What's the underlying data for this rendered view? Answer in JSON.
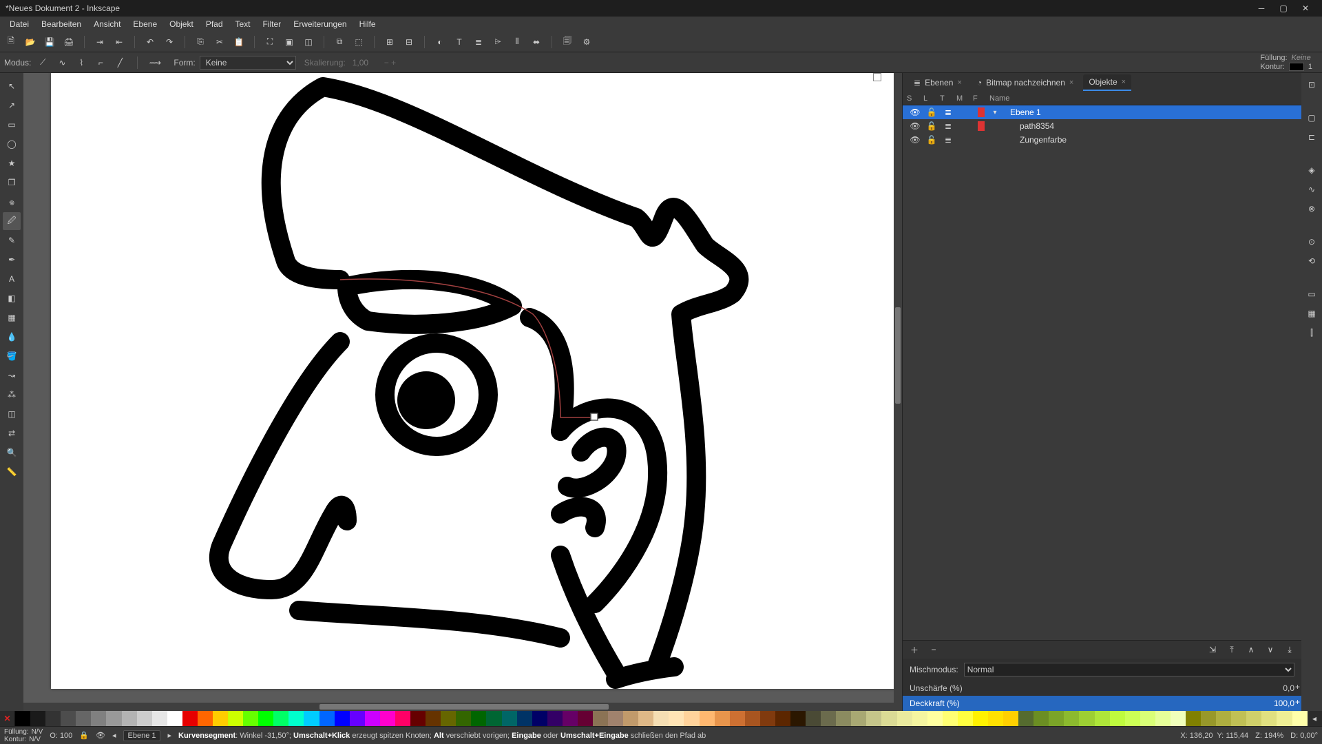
{
  "title": "*Neues Dokument 2 - Inkscape",
  "menu": [
    "Datei",
    "Bearbeiten",
    "Ansicht",
    "Ebene",
    "Objekt",
    "Pfad",
    "Text",
    "Filter",
    "Erweiterungen",
    "Hilfe"
  ],
  "tooloptions": {
    "modus_label": "Modus:",
    "form_label": "Form:",
    "form_value": "Keine",
    "scale_label": "Skalierung:",
    "scale_value": "1,00",
    "right_fill_label": "Füllung:",
    "right_fill_value": "Keine",
    "right_stroke_label": "Kontur:",
    "right_stroke_value": "1"
  },
  "dock": {
    "tabs": [
      {
        "label": "Ebenen",
        "close": "×"
      },
      {
        "label": "Bitmap nachzeichnen",
        "close": "×"
      },
      {
        "label": "Objekte",
        "close": "×"
      }
    ],
    "active_tab": 2,
    "headers": {
      "s": "S",
      "l": "L",
      "t": "T",
      "m": "M",
      "f": "F",
      "name": "Name"
    },
    "rows": [
      {
        "name": "Ebene 1",
        "selected": true,
        "expander": "▾",
        "color": "#de3333"
      },
      {
        "name": "path8354",
        "selected": false,
        "expander": "",
        "color": "#de3333",
        "indent": 1
      },
      {
        "name": "Zungenfarbe",
        "selected": false,
        "expander": "",
        "color": "",
        "indent": 1
      }
    ],
    "blend_label": "Mischmodus:",
    "blend_value": "Normal",
    "blur_label": "Unschärfe (%)",
    "blur_value": "0,0",
    "opacity_label": "Deckkraft (%)",
    "opacity_value": "100,0"
  },
  "status": {
    "fill_label": "Füllung:",
    "fill_value": "N/V",
    "stroke_label": "Kontur:",
    "stroke_value": "N/V",
    "o_label": "O:",
    "o_value": "100",
    "layer": "Ebene 1",
    "hint_prefix": "Kurvensegment",
    "hint_angle": ": Winkel -31,50°;",
    "hint_b1": "Umschalt+Klick",
    "hint_t1": " erzeugt spitzen Knoten; ",
    "hint_b2": "Alt",
    "hint_t2": " verschiebt vorigen; ",
    "hint_b3": "Eingabe",
    "hint_t3": " oder ",
    "hint_b4": "Umschalt+Eingabe",
    "hint_t4": " schließen den Pfad ab",
    "x_label": "X:",
    "x_value": "136,20",
    "y_label": "Y:",
    "y_value": "115,44",
    "z_label": "Z:",
    "z_value": "194%",
    "d_label": "D:",
    "d_value": "0,00°"
  },
  "palette_colors": [
    "#000000",
    "#1a1a1a",
    "#333333",
    "#4d4d4d",
    "#666666",
    "#808080",
    "#999999",
    "#b3b3b3",
    "#cccccc",
    "#e6e6e6",
    "#ffffff",
    "#e60000",
    "#ff6600",
    "#ffcc00",
    "#ccff00",
    "#66ff00",
    "#00ff00",
    "#00ff66",
    "#00ffcc",
    "#00ccff",
    "#0066ff",
    "#0000ff",
    "#6600ff",
    "#cc00ff",
    "#ff00cc",
    "#ff0066",
    "#660000",
    "#663300",
    "#666600",
    "#336600",
    "#006600",
    "#006633",
    "#006666",
    "#003366",
    "#000066",
    "#330066",
    "#660066",
    "#660033",
    "#8b7355",
    "#a0826d",
    "#c19a6b",
    "#deb887",
    "#f5deb3",
    "#ffe4b5",
    "#ffd39b",
    "#ffb870",
    "#e8954c",
    "#cd7032",
    "#a85520",
    "#803a0e",
    "#5c2600",
    "#2b1700",
    "#4a4a35",
    "#6b6b4d",
    "#8b8b60",
    "#a8a873",
    "#c5c58a",
    "#dbdb95",
    "#eaea9e",
    "#f5f5a0",
    "#ffffa0",
    "#ffff73",
    "#ffff40",
    "#fff200",
    "#ffe100",
    "#ffd000",
    "#556b2f",
    "#6b8e23",
    "#7ba428",
    "#8cba2e",
    "#9dcf33",
    "#aee539",
    "#bffb3e",
    "#ccff55",
    "#d9ff77",
    "#e6ff99",
    "#f0ffbb",
    "#808000",
    "#98982a",
    "#afaf40",
    "#c0c055",
    "#d0d06a",
    "#e0e080",
    "#efef95",
    "#ffffaa"
  ]
}
